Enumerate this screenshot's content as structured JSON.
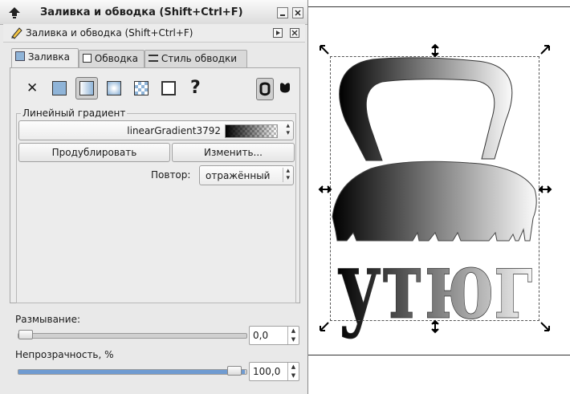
{
  "window": {
    "title": "Заливка и обводка (Shift+Ctrl+F)",
    "dock_title": "Заливка и обводка (Shift+Ctrl+F)"
  },
  "tabs": [
    {
      "label": "Заливка",
      "active": true
    },
    {
      "label": "Обводка",
      "active": false
    },
    {
      "label": "Стиль обводки",
      "active": false
    }
  ],
  "paint_modes": [
    {
      "name": "no-paint",
      "glyph": "✕"
    },
    {
      "name": "flat-color"
    },
    {
      "name": "linear-gradient",
      "selected": true
    },
    {
      "name": "radial-gradient"
    },
    {
      "name": "pattern"
    },
    {
      "name": "swatch"
    },
    {
      "name": "unset",
      "glyph": "?"
    }
  ],
  "fill_rule_icons": [
    "fill-rule-evenodd-icon",
    "fill-rule-nonzero-icon"
  ],
  "gradient": {
    "section_label": "Линейный градиент",
    "selected": "linearGradient3792",
    "duplicate_label": "Продублировать",
    "edit_label": "Изменить...",
    "repeat_label": "Повтор:",
    "repeat_value": "отражённый"
  },
  "blur": {
    "label": "Размывание:",
    "value": "0,0",
    "level": 0.0
  },
  "opacity": {
    "label": "Непрозрачность, %",
    "value": "100,0",
    "level": 1.0
  },
  "canvas": {
    "artwork_text": "утюг"
  },
  "colors": {
    "accent": "#8fb4d8",
    "slider_fill": "#6f9bd1",
    "window_bg": "#e9e9e9"
  }
}
